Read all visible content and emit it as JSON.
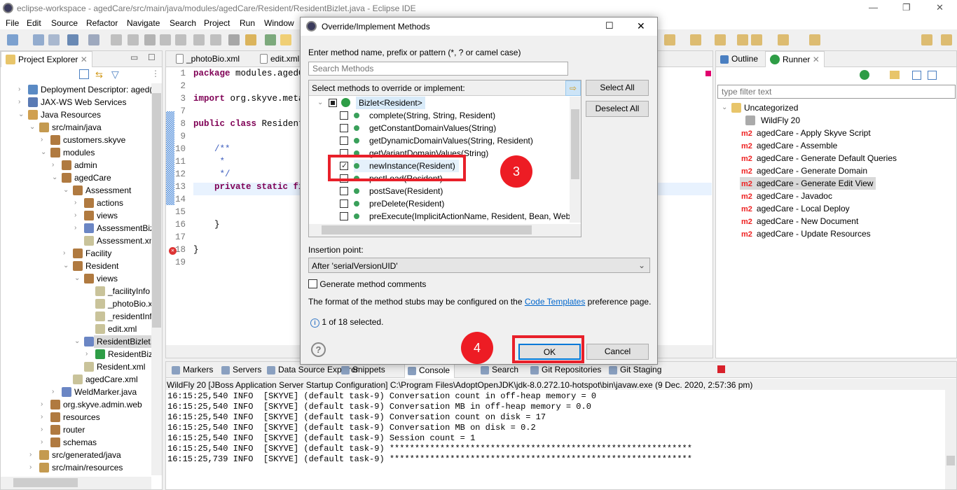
{
  "window": {
    "title": "eclipse-workspace - agedCare/src/main/java/modules/agedCare/Resident/ResidentBizlet.java - Eclipse IDE"
  },
  "menu": [
    "File",
    "Edit",
    "Source",
    "Refactor",
    "Navigate",
    "Search",
    "Project",
    "Run",
    "Window"
  ],
  "project_explorer": {
    "title": "Project Explorer",
    "items": [
      {
        "label": "Deployment Descriptor: aged(",
        "level": 0,
        "arrow": "right",
        "icon": "deployment-descriptor-icon"
      },
      {
        "label": "JAX-WS Web Services",
        "level": 0,
        "arrow": "right",
        "icon": "web-services-icon"
      },
      {
        "label": "Java Resources",
        "level": 0,
        "arrow": "down",
        "icon": "java-resources-icon"
      },
      {
        "label": "src/main/java",
        "level": 1,
        "arrow": "down",
        "icon": "source-folder-icon"
      },
      {
        "label": "customers.skyve",
        "level": 2,
        "arrow": "right",
        "icon": "package-icon"
      },
      {
        "label": "modules",
        "level": 2,
        "arrow": "down",
        "icon": "package-icon"
      },
      {
        "label": "admin",
        "level": 3,
        "arrow": "right",
        "icon": "package-icon"
      },
      {
        "label": "agedCare",
        "level": 3,
        "arrow": "down",
        "icon": "package-icon"
      },
      {
        "label": "Assessment",
        "level": 4,
        "arrow": "down",
        "icon": "package-icon"
      },
      {
        "label": "actions",
        "level": 5,
        "arrow": "right",
        "icon": "package-icon"
      },
      {
        "label": "views",
        "level": 5,
        "arrow": "right",
        "icon": "package-icon"
      },
      {
        "label": "AssessmentBiz",
        "level": 5,
        "arrow": "right",
        "icon": "java-file-icon"
      },
      {
        "label": "Assessment.xm",
        "level": 5,
        "arrow": "",
        "icon": "xml-file-icon"
      },
      {
        "label": "Facility",
        "level": 4,
        "arrow": "right",
        "icon": "package-icon"
      },
      {
        "label": "Resident",
        "level": 4,
        "arrow": "down",
        "icon": "package-icon"
      },
      {
        "label": "views",
        "level": 5,
        "arrow": "down",
        "icon": "package-icon"
      },
      {
        "label": "_facilityInfo",
        "level": 6,
        "arrow": "",
        "icon": "xml-file-icon"
      },
      {
        "label": "_photoBio.x",
        "level": 6,
        "arrow": "",
        "icon": "xml-file-icon"
      },
      {
        "label": "_residentInf",
        "level": 6,
        "arrow": "",
        "icon": "xml-file-icon"
      },
      {
        "label": "edit.xml",
        "level": 6,
        "arrow": "",
        "icon": "xml-file-icon"
      },
      {
        "label": "ResidentBizlet.j",
        "level": 5,
        "arrow": "down",
        "icon": "java-file-icon",
        "selected": true
      },
      {
        "label": "ResidentBiz",
        "level": 6,
        "arrow": "right",
        "icon": "class-icon"
      },
      {
        "label": "Resident.xml",
        "level": 5,
        "arrow": "",
        "icon": "xml-file-icon"
      },
      {
        "label": "agedCare.xml",
        "level": 4,
        "arrow": "",
        "icon": "xml-file-icon"
      },
      {
        "label": "WeldMarker.java",
        "level": 3,
        "arrow": "right",
        "icon": "java-file-icon"
      },
      {
        "label": "org.skyve.admin.web",
        "level": 2,
        "arrow": "right",
        "icon": "package-icon"
      },
      {
        "label": "resources",
        "level": 2,
        "arrow": "right",
        "icon": "package-icon"
      },
      {
        "label": "router",
        "level": 2,
        "arrow": "right",
        "icon": "package-icon"
      },
      {
        "label": "schemas",
        "level": 2,
        "arrow": "right",
        "icon": "package-icon"
      },
      {
        "label": "src/generated/java",
        "level": 1,
        "arrow": "right",
        "icon": "source-folder-icon"
      },
      {
        "label": "src/main/resources",
        "level": 1,
        "arrow": "right",
        "icon": "source-folder-icon"
      }
    ]
  },
  "editor": {
    "tabs": [
      "_photoBio.xml",
      "edit.xml"
    ],
    "lines": [
      {
        "n": "1",
        "kw": "package",
        "text": " modules.agedCa"
      },
      {
        "n": "2",
        "kw": "",
        "text": ""
      },
      {
        "n": "3",
        "kw": "import",
        "text": " org.skyve.metad"
      },
      {
        "n": "7",
        "kw": "",
        "text": ""
      },
      {
        "n": "8",
        "kw": "public class",
        "text": " ResidentB"
      },
      {
        "n": "9",
        "kw": "",
        "text": ""
      },
      {
        "n": "10",
        "cm": "    /**"
      },
      {
        "n": "11",
        "cm": "     *"
      },
      {
        "n": "12",
        "cm": "     */"
      },
      {
        "n": "13",
        "kw": "    private static fin",
        "text": ""
      },
      {
        "n": "14",
        "kw": "",
        "text": ""
      },
      {
        "n": "15",
        "kw": "",
        "text": ""
      },
      {
        "n": "16",
        "kw": "",
        "text": "    }"
      },
      {
        "n": "17",
        "kw": "",
        "text": ""
      },
      {
        "n": "18",
        "kw": "",
        "text": "}"
      },
      {
        "n": "19",
        "kw": "",
        "text": ""
      }
    ]
  },
  "dialog": {
    "title": "Override/Implement Methods",
    "filter_label": "Enter method name, prefix or pattern (*, ? or camel case)",
    "filter_placeholder": "Search Methods",
    "methods_label": "Select methods to override or implement:",
    "root": "Bizlet<Resident>",
    "methods": [
      {
        "label": "complete(String, String, Resident)",
        "checked": false
      },
      {
        "label": "getConstantDomainValues(String)",
        "checked": false
      },
      {
        "label": "getDynamicDomainValues(String, Resident)",
        "checked": false
      },
      {
        "label": "getVariantDomainValues(String)",
        "checked": false
      },
      {
        "label": "newInstance(Resident)",
        "checked": true
      },
      {
        "label": "postLoad(Resident)",
        "checked": false
      },
      {
        "label": "postSave(Resident)",
        "checked": false
      },
      {
        "label": "preDelete(Resident)",
        "checked": false
      },
      {
        "label": "preExecute(ImplicitActionName, Resident, Bean, WebC",
        "checked": false
      }
    ],
    "select_all": "Select All",
    "deselect_all": "Deselect All",
    "insertion_label": "Insertion point:",
    "insertion_value": "After 'serialVersionUID'",
    "generate_comments": "Generate method comments",
    "format_pre": "The format of the method stubs may be configured on the ",
    "format_link": "Code Templates",
    "format_post": " preference page.",
    "status": "1 of 18 selected.",
    "ok": "OK",
    "cancel": "Cancel"
  },
  "annotations": {
    "step3": "3",
    "step4": "4",
    "color": "#e8202a"
  },
  "runner": {
    "tabs": [
      "Outline",
      "Runner"
    ],
    "filter_placeholder": "type filter text",
    "category": "Uncategorized",
    "items": [
      {
        "label": "WildFly 20",
        "icon": "server-icon"
      },
      {
        "label": "agedCare - Apply Skyve Script",
        "icon": "m2",
        "badge": "m2"
      },
      {
        "label": "agedCare - Assemble",
        "badge": "m2"
      },
      {
        "label": "agedCare - Generate Default Queries",
        "badge": "m2"
      },
      {
        "label": "agedCare - Generate Domain",
        "badge": "m2"
      },
      {
        "label": "agedCare - Generate Edit View",
        "badge": "m2",
        "selected": true
      },
      {
        "label": "agedCare - Javadoc",
        "badge": "m2"
      },
      {
        "label": "agedCare - Local Deploy",
        "badge": "m2"
      },
      {
        "label": "agedCare - New Document",
        "badge": "m2"
      },
      {
        "label": "agedCare - Update Resources",
        "badge": "m2"
      }
    ]
  },
  "console": {
    "tabs": [
      "Markers",
      "Servers",
      "Data Source Explorer",
      "Snippets",
      "Console",
      "Search",
      "Git Repositories",
      "Git Staging"
    ],
    "header": "WildFly 20 [JBoss Application Server Startup Configuration] C:\\Program Files\\AdoptOpenJDK\\jdk-8.0.272.10-hotspot\\bin\\javaw.exe  (9 Dec. 2020, 2:57:36 pm)",
    "lines": [
      "16:15:25,540 INFO  [SKYVE] (default task-9) Conversation count in off-heap memory = 0",
      "16:15:25,540 INFO  [SKYVE] (default task-9) Conversation MB in off-heap memory = 0.0",
      "16:15:25,540 INFO  [SKYVE] (default task-9) Conversation count on disk = 17",
      "16:15:25,540 INFO  [SKYVE] (default task-9) Conversation MB on disk = 0.2",
      "16:15:25,540 INFO  [SKYVE] (default task-9) Session count = 1",
      "16:15:25,540 INFO  [SKYVE] (default task-9) ************************************************************",
      "16:15:25,739 INFO  [SKYVE] (default task-9) ************************************************************"
    ]
  }
}
